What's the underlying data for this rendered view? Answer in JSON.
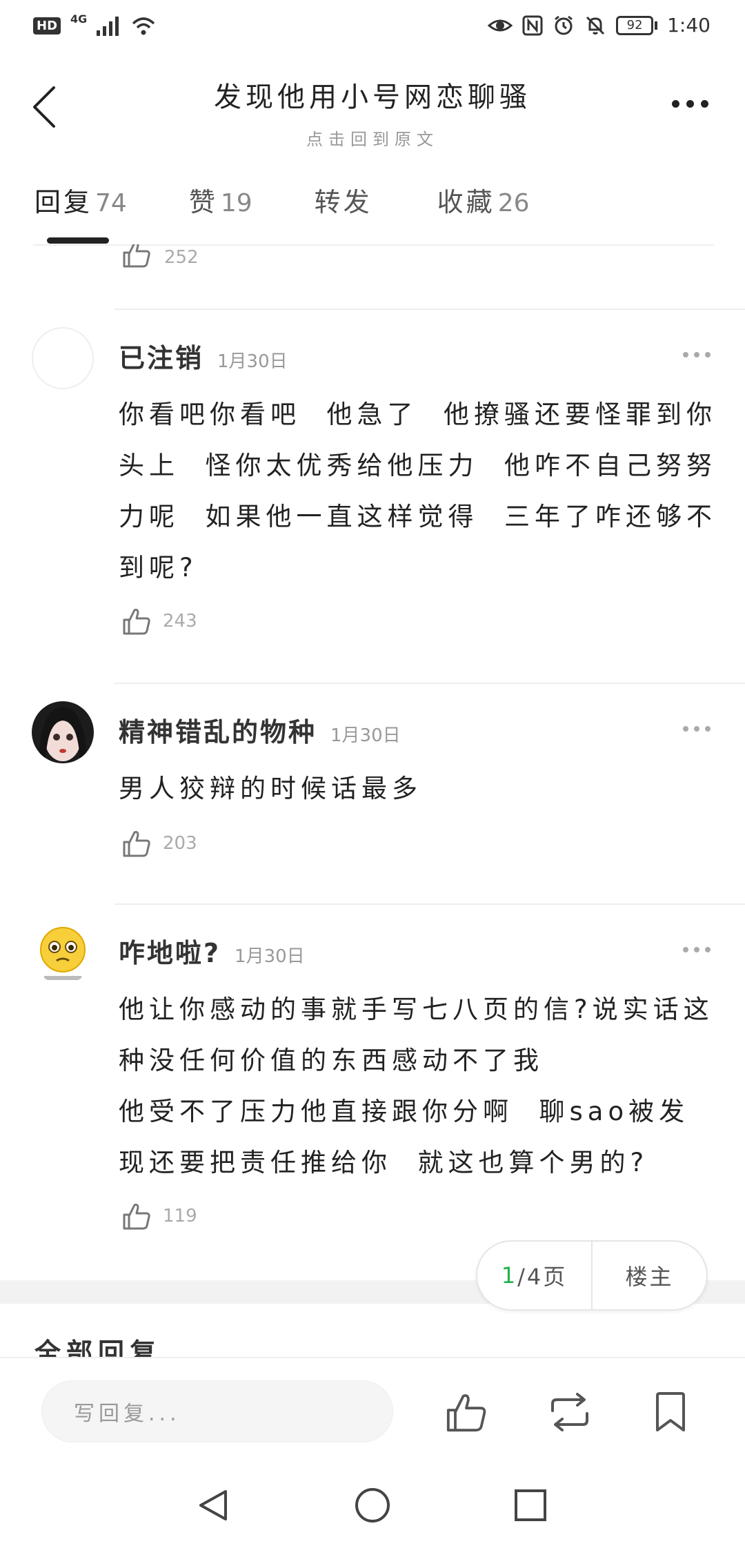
{
  "status_bar": {
    "hd": "HD",
    "network": "4G",
    "battery": "92",
    "time": "1:40"
  },
  "header": {
    "title": "发现他用小号网恋聊骚",
    "subtitle": "点击回到原文"
  },
  "tabs": [
    {
      "label": "回复",
      "count": "74",
      "active": true
    },
    {
      "label": "赞",
      "count": "19"
    },
    {
      "label": "转发",
      "count": ""
    },
    {
      "label": "收藏",
      "count": "26"
    }
  ],
  "partial_like_count": "252",
  "comments": [
    {
      "name": "已注销",
      "date": "1月30日",
      "content": "你看吧你看吧  他急了  他撩骚还要怪罪到你头上  怪你太优秀给他压力  他咋不自己努努力呢  如果他一直这样觉得  三年了咋还够不到呢?",
      "likes": "243"
    },
    {
      "name": "精神错乱的物种",
      "date": "1月30日",
      "content": "男人狡辩的时候话最多",
      "likes": "203"
    },
    {
      "name": "咋地啦?",
      "date": "1月30日",
      "content": "他让你感动的事就手写七八页的信?说实话这种没任何价值的东西感动不了我\n他受不了压力他直接跟你分啊  聊sao被发现还要把责任推给你  就这也算个男的?",
      "likes": "119"
    }
  ],
  "pager": {
    "current": "1",
    "total_label": "/4页",
    "owner_label": "楼主"
  },
  "section": {
    "all_replies": "全部回复"
  },
  "bottom_bar": {
    "reply_placeholder": "写回复..."
  },
  "colors": {
    "accent_green": "#21b24b",
    "text_primary": "#222222",
    "text_muted": "#999999"
  }
}
